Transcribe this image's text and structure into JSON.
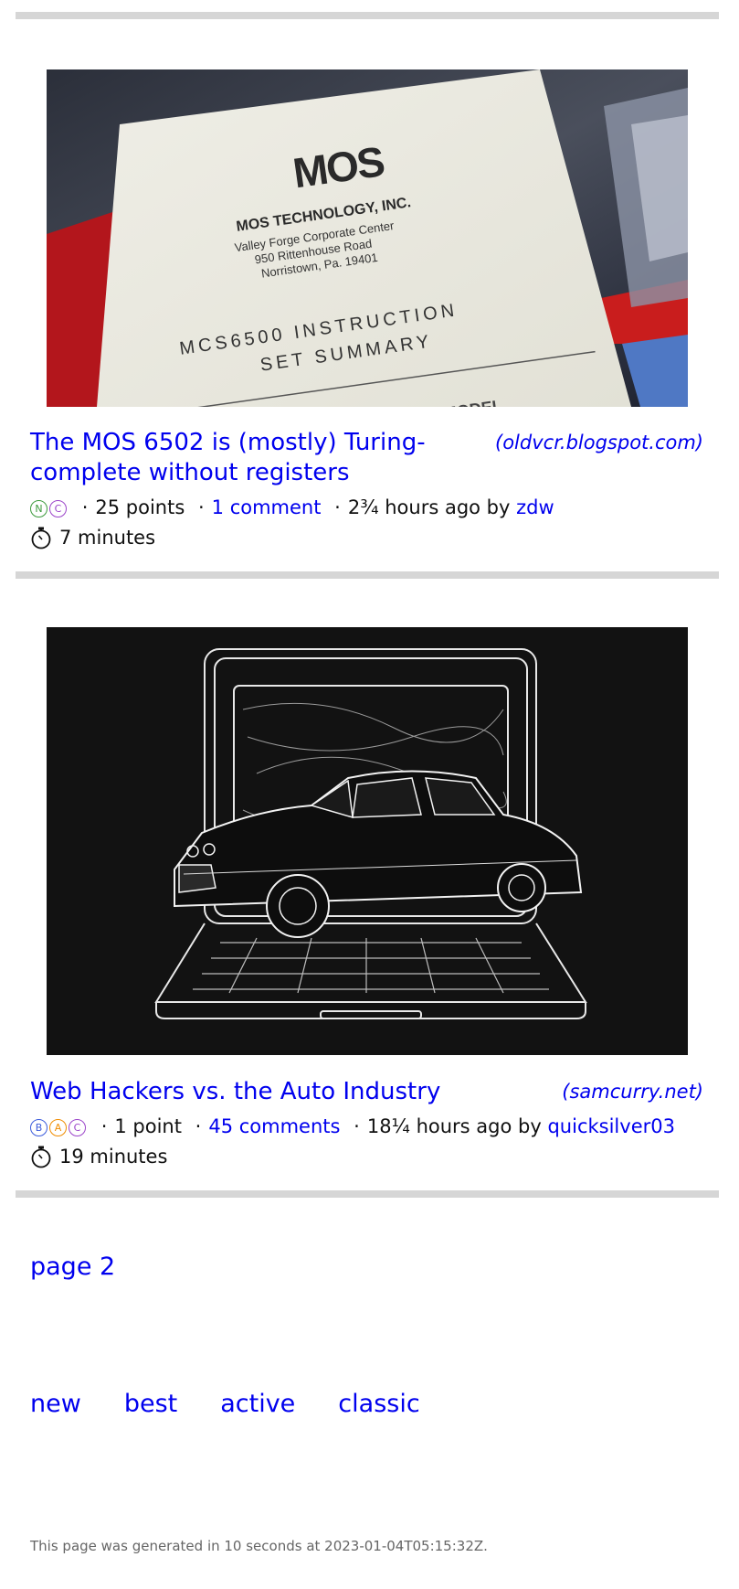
{
  "stories": [
    {
      "title": "The MOS 6502 is (mostly) Turing-complete without registers",
      "domain": "(oldvcr.blogspot.com)",
      "badges": [
        {
          "letter": "N",
          "color": "#3c9a3c"
        },
        {
          "letter": "C",
          "color": "#9b44c9"
        }
      ],
      "points": "25 points",
      "comments": "1 comment",
      "age": "2¾ hours ago by",
      "author": "zdw",
      "read_time": "7 minutes",
      "image": {
        "card_title": "MOS TECHNOLOGY, INC.",
        "card_addr1": "Valley Forge Corporate Center",
        "card_addr2": "950 Rittenhouse Road",
        "card_addr3": "Norristown, Pa. 19401",
        "card_heading1": "MCS6500   INSTRUCTION",
        "card_heading2": "SET    SUMMARY",
        "card_footer": "PROGRAMMING  MODEL"
      }
    },
    {
      "title": "Web Hackers vs. the Auto Industry",
      "domain": "(samcurry.net)",
      "badges": [
        {
          "letter": "B",
          "color": "#3b5bdb"
        },
        {
          "letter": "A",
          "color": "#f08c00"
        },
        {
          "letter": "C",
          "color": "#9b44c9"
        }
      ],
      "points": "1 point",
      "comments": "45 comments",
      "age": "18¼ hours ago by",
      "author": "quicksilver03",
      "read_time": "19 minutes"
    }
  ],
  "pager": {
    "label": "page 2"
  },
  "nav": [
    "new",
    "best",
    "active",
    "classic"
  ],
  "footer": "This page was generated in 10 seconds at 2023-01-04T05:15:32Z."
}
